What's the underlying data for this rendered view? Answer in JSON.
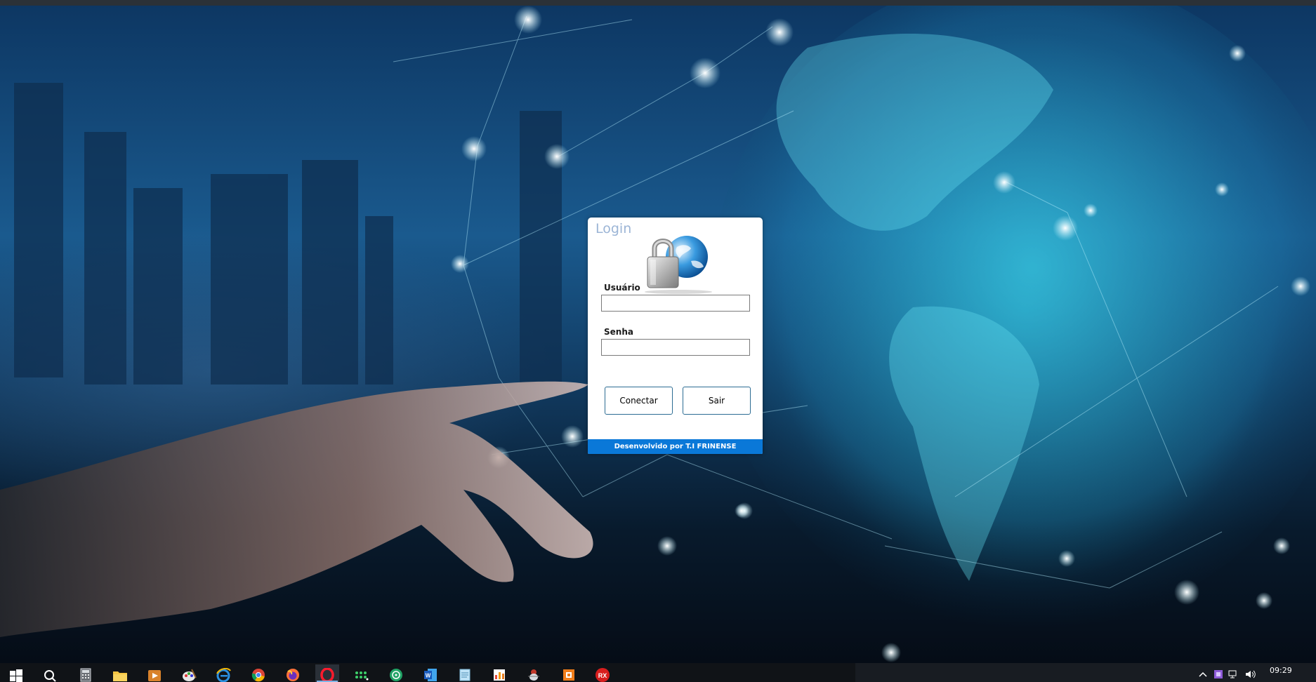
{
  "login": {
    "title": "Login",
    "username_label": "Usuário",
    "username_value": "",
    "password_label": "Senha",
    "password_value": "",
    "connect_button": "Conectar",
    "exit_button": "Sair",
    "footer": "Desenvolvido por T.I FRINENSE"
  },
  "taskbar": {
    "clock_time": "09:29",
    "apps": [
      {
        "name": "start-icon"
      },
      {
        "name": "search-icon"
      },
      {
        "name": "calculator-icon"
      },
      {
        "name": "file-explorer-icon"
      },
      {
        "name": "media-player-icon"
      },
      {
        "name": "paint-icon"
      },
      {
        "name": "internet-explorer-icon"
      },
      {
        "name": "chrome-icon"
      },
      {
        "name": "firefox-icon"
      },
      {
        "name": "opera-icon"
      },
      {
        "name": "dots-app-icon"
      },
      {
        "name": "green-app-icon"
      },
      {
        "name": "word-icon"
      },
      {
        "name": "notepad-icon"
      },
      {
        "name": "chart-app-icon"
      },
      {
        "name": "bug-app-icon"
      },
      {
        "name": "orange-app-icon"
      },
      {
        "name": "rx-app-icon",
        "label": "RX"
      }
    ]
  },
  "colors": {
    "footer_bg": "#0a78d8",
    "title": "#9cb5d6",
    "button_border": "#2c6c93"
  }
}
